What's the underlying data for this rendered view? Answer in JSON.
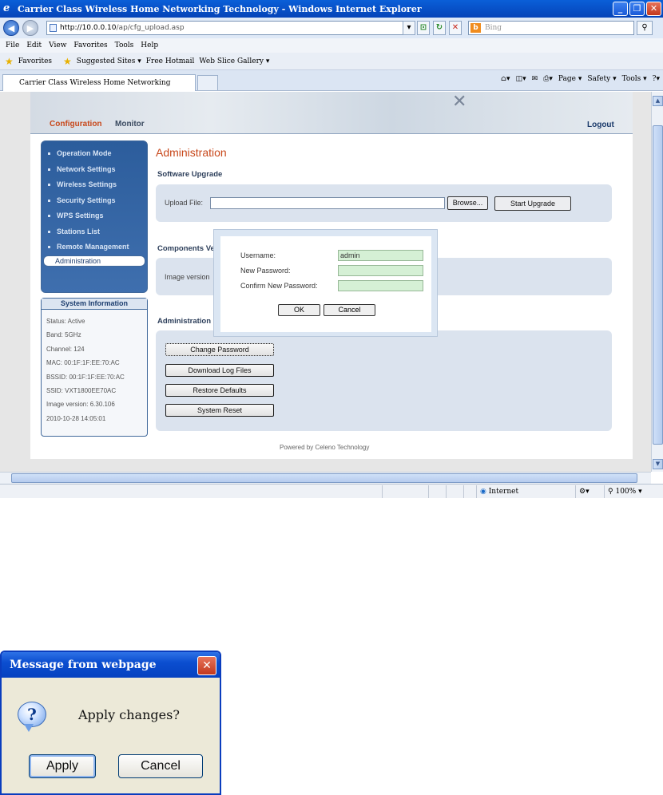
{
  "window": {
    "title": "Carrier Class Wireless Home Networking Technology - Windows Internet Explorer",
    "minimize": "_",
    "maximize": "❐",
    "close": "✕"
  },
  "toolbar": {
    "url_host": "http://10.0.0.10",
    "url_path": "/ap/cfg_upload.asp",
    "search_placeholder": "Bing"
  },
  "menu": [
    "File",
    "Edit",
    "View",
    "Favorites",
    "Tools",
    "Help"
  ],
  "favorites": {
    "label": "Favorites",
    "items": [
      "Suggested Sites ▾",
      "Free Hotmail",
      "Web Slice Gallery ▾"
    ]
  },
  "tab": {
    "title": "Carrier Class Wireless Home Networking Technology"
  },
  "commandbar": [
    "Page ▾",
    "Safety ▾",
    "Tools ▾"
  ],
  "statusbar": {
    "zone": "Internet",
    "zoom": "100%"
  },
  "page": {
    "top_tabs": {
      "configuration": "Configuration",
      "monitor": "Monitor",
      "logout": "Logout"
    },
    "nav": [
      "Operation Mode",
      "Network Settings",
      "Wireless Settings",
      "Security Settings",
      "WPS Settings",
      "Stations List",
      "Remote Management",
      "Administration"
    ],
    "nav_active": "Administration",
    "system_info": {
      "title": "System Information",
      "lines": [
        "Status: Active",
        "Band: 5GHz",
        "Channel: 124",
        "MAC: 00:1F:1F:EE:70:AC",
        "BSSID: 00:1F:1F:EE:70:AC",
        "SSID: VXT1800EE70AC",
        "Image version: 6.30.106",
        "2010-10-28 14:05:01"
      ]
    },
    "heading": "Administration",
    "software_upgrade": {
      "title": "Software Upgrade",
      "upload_label": "Upload File:",
      "browse": "Browse...",
      "start": "Start Upgrade"
    },
    "components": {
      "title": "Components Ve",
      "image_label": "Image version"
    },
    "administration": {
      "title": "Administration",
      "buttons": [
        "Change Password",
        "Download Log Files",
        "Restore Defaults",
        "System Reset"
      ]
    },
    "footer": "Powered by Celeno Technology"
  },
  "password_dialog": {
    "username_label": "Username:",
    "username_value": "admin",
    "new_password_label": "New Password:",
    "confirm_label": "Confirm New Password:",
    "ok": "OK",
    "cancel": "Cancel"
  },
  "message_box": {
    "title": "Message from webpage",
    "text": "Apply changes?",
    "icon": "question-icon",
    "apply": "Apply",
    "cancel": "Cancel"
  }
}
